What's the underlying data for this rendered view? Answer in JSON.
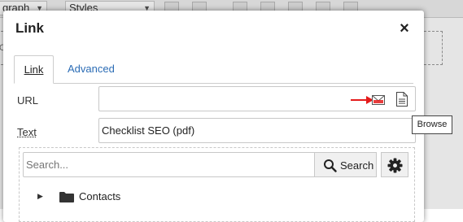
{
  "background": {
    "paragraph_select": "graph",
    "styles_select": "Styles",
    "dashed_text": "O"
  },
  "dialog": {
    "title": "Link",
    "close_glyph": "×",
    "tabs": [
      {
        "label": "Link",
        "active": true
      },
      {
        "label": "Advanced",
        "active": false
      }
    ],
    "url": {
      "label": "URL",
      "value": ""
    },
    "text": {
      "label": "Text",
      "value": "Checklist SEO (pdf)"
    },
    "browse_tooltip": "Browse",
    "browser": {
      "search_placeholder": "Search...",
      "search_button": "Search",
      "tree": [
        {
          "label": "Contacts",
          "icon": "folder-icon",
          "toggle": "▶"
        }
      ]
    }
  },
  "colors": {
    "tab_link": "#2b6cb5",
    "annotation_arrow": "#e41b1b",
    "envelope_red": "#e41b1b"
  }
}
